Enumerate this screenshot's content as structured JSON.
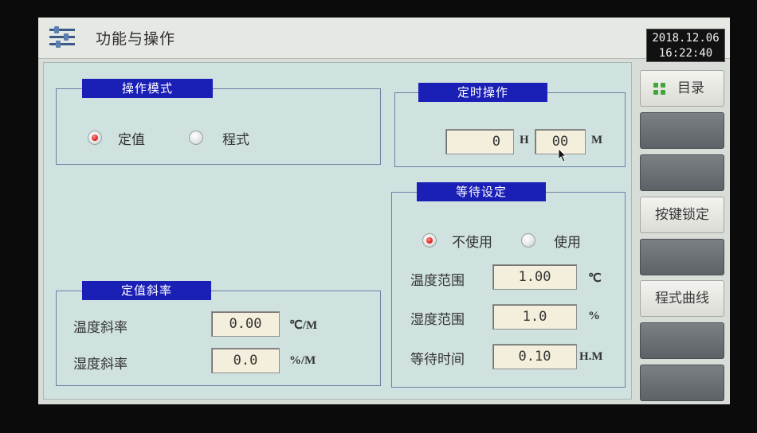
{
  "header": {
    "title": "功能与操作",
    "date": "2018.12.06",
    "time": "16:22:40",
    "menu_icon": "settings-sliders-icon"
  },
  "operation_mode": {
    "title": "操作模式",
    "options": [
      {
        "label": "定值",
        "selected": true
      },
      {
        "label": "程式",
        "selected": false
      }
    ]
  },
  "timer": {
    "title": "定时操作",
    "hours": "0",
    "hours_unit": "H",
    "minutes": "00",
    "minutes_unit": "M"
  },
  "wait_settings": {
    "title": "等待设定",
    "options": [
      {
        "label": "不使用",
        "selected": true
      },
      {
        "label": "使用",
        "selected": false
      }
    ],
    "rows": [
      {
        "label": "温度范围",
        "value": "1.00",
        "unit": "℃"
      },
      {
        "label": "湿度范围",
        "value": "1.0",
        "unit": "%"
      },
      {
        "label": "等待时间",
        "value": "0.10",
        "unit": "H.M"
      }
    ]
  },
  "ramp": {
    "title": "定值斜率",
    "rows": [
      {
        "label": "温度斜率",
        "value": "0.00",
        "unit": "℃/M"
      },
      {
        "label": "湿度斜率",
        "value": "0.0",
        "unit": "%/M"
      }
    ]
  },
  "side_buttons": [
    {
      "label": "目录",
      "style": "light",
      "icon": "grid-dots-icon"
    },
    {
      "label": "",
      "style": "dark"
    },
    {
      "label": "",
      "style": "dark"
    },
    {
      "label": "按键锁定",
      "style": "light"
    },
    {
      "label": "",
      "style": "dark"
    },
    {
      "label": "程式曲线",
      "style": "light"
    },
    {
      "label": "",
      "style": "dark"
    },
    {
      "label": "",
      "style": "dark"
    }
  ],
  "colors": {
    "group_title_bg": "#1a1fb6",
    "panel_bg": "#cfe2e0",
    "field_bg": "#f4efdd",
    "radio_selected": "#e12525",
    "menu_dots": "#41a63a"
  }
}
